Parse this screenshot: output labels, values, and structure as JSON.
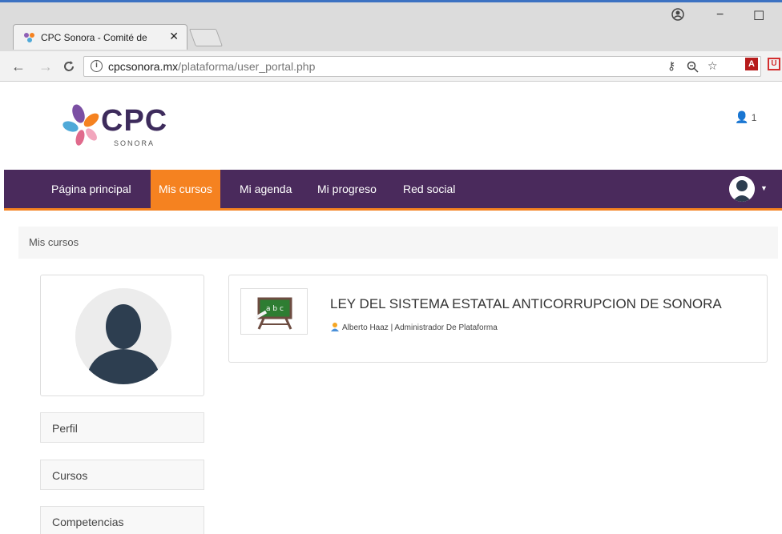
{
  "browser": {
    "tab_title": "CPC Sonora - Comité de",
    "tab_close": "✕",
    "url_host": "cpcsonora.mx",
    "url_path": "/plataforma/user_portal.php",
    "window_controls": [
      "−",
      "☐"
    ]
  },
  "site": {
    "logo_text": "CPC",
    "logo_sub": "SONORA",
    "user_count": "1",
    "accent_color": "#f58220",
    "nav_color": "#4a2a5c"
  },
  "nav": {
    "items": [
      {
        "label": "Página principal"
      },
      {
        "label": "Mis cursos"
      },
      {
        "label": "Mi agenda"
      },
      {
        "label": "Mi progreso"
      },
      {
        "label": "Red social"
      }
    ],
    "active_index": 1
  },
  "breadcrumb": {
    "label": "Mis cursos"
  },
  "sidebar": {
    "links": [
      {
        "label": "Perfil"
      },
      {
        "label": "Cursos"
      },
      {
        "label": "Competencias"
      }
    ]
  },
  "course": {
    "title": "LEY DEL SISTEMA ESTATAL ANTICORRUPCION DE SONORA",
    "teacher": "Alberto Haaz | Administrador De Plataforma",
    "thumb_text": "a b c"
  }
}
